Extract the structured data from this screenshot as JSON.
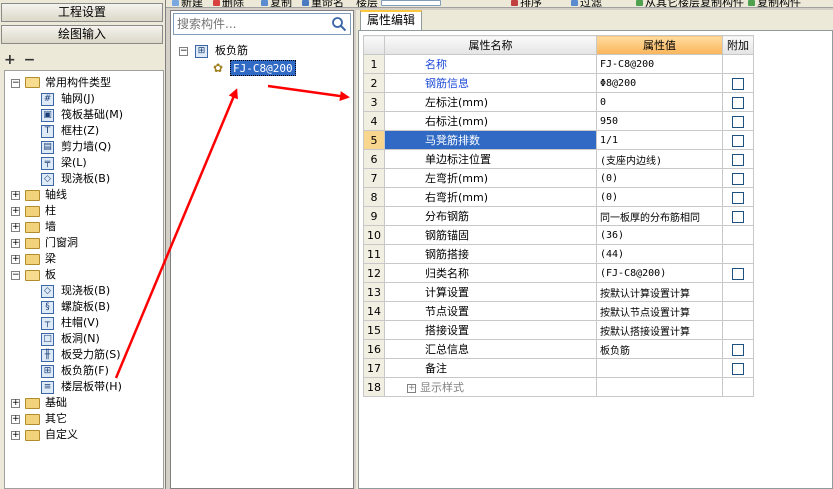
{
  "toolbar": {
    "items": [
      "新建",
      "删除",
      "复制",
      "重命名",
      "楼层",
      "排序",
      "过滤",
      "从其它楼层复制构件",
      "复制构件"
    ]
  },
  "left": {
    "btn_engineering": "工程设置",
    "btn_drawing": "绘图输入",
    "tools": [
      "+",
      "−"
    ],
    "tree": {
      "common": "常用构件类型",
      "common_items": [
        "轴网(J)",
        "筏板基础(M)",
        "框柱(Z)",
        "剪力墙(Q)",
        "梁(L)",
        "现浇板(B)"
      ],
      "axis": "轴线",
      "column": "柱",
      "wall": "墙",
      "door_window": "门窗洞",
      "beam": "梁",
      "slab": "板",
      "slab_items": [
        "现浇板(B)",
        "螺旋板(B)",
        "柱帽(V)",
        "板洞(N)",
        "板受力筋(S)",
        "板负筋(F)",
        "楼层板带(H)"
      ],
      "foundation": "基础",
      "other": "其它",
      "custom": "自定义"
    }
  },
  "middle": {
    "search_placeholder": "搜索构件...",
    "root": "板负筋",
    "node": "FJ-C8@200"
  },
  "right": {
    "tab": "属性编辑",
    "headers": {
      "name": "属性名称",
      "value": "属性值",
      "attach": "附加"
    },
    "rows": [
      {
        "num": "1",
        "name": "名称",
        "value": "FJ-C8@200",
        "blue": true,
        "check": false
      },
      {
        "num": "2",
        "name": "钢筋信息",
        "value": "Φ8@200",
        "blue": true,
        "check": true
      },
      {
        "num": "3",
        "name": "左标注(mm)",
        "value": "0",
        "blue": false,
        "check": true
      },
      {
        "num": "4",
        "name": "右标注(mm)",
        "value": "950",
        "blue": false,
        "check": true
      },
      {
        "num": "5",
        "name": "马凳筋排数",
        "value": "1/1",
        "blue": false,
        "check": true,
        "selected": true
      },
      {
        "num": "6",
        "name": "单边标注位置",
        "value": "(支座内边线)",
        "blue": false,
        "check": true
      },
      {
        "num": "7",
        "name": "左弯折(mm)",
        "value": "(0)",
        "blue": false,
        "check": true
      },
      {
        "num": "8",
        "name": "右弯折(mm)",
        "value": "(0)",
        "blue": false,
        "check": true
      },
      {
        "num": "9",
        "name": "分布钢筋",
        "value": "同一板厚的分布筋相同",
        "blue": false,
        "check": true
      },
      {
        "num": "10",
        "name": "钢筋锚固",
        "value": "(36)",
        "blue": false,
        "check": false
      },
      {
        "num": "11",
        "name": "钢筋搭接",
        "value": "(44)",
        "blue": false,
        "check": false
      },
      {
        "num": "12",
        "name": "归类名称",
        "value": "(FJ-C8@200)",
        "blue": false,
        "check": true
      },
      {
        "num": "13",
        "name": "计算设置",
        "value": "按默认计算设置计算",
        "blue": false,
        "check": false
      },
      {
        "num": "14",
        "name": "节点设置",
        "value": "按默认节点设置计算",
        "blue": false,
        "check": false
      },
      {
        "num": "15",
        "name": "搭接设置",
        "value": "按默认搭接设置计算",
        "blue": false,
        "check": false
      },
      {
        "num": "16",
        "name": "汇总信息",
        "value": "板负筋",
        "blue": false,
        "check": true
      },
      {
        "num": "17",
        "name": "备注",
        "value": "",
        "blue": false,
        "check": true
      }
    ],
    "row18": {
      "num": "18",
      "name": "显示样式"
    }
  },
  "colors": {
    "selection": "#316ac5",
    "arrow": "#ff0000",
    "header_accent": "#f9b55a"
  }
}
